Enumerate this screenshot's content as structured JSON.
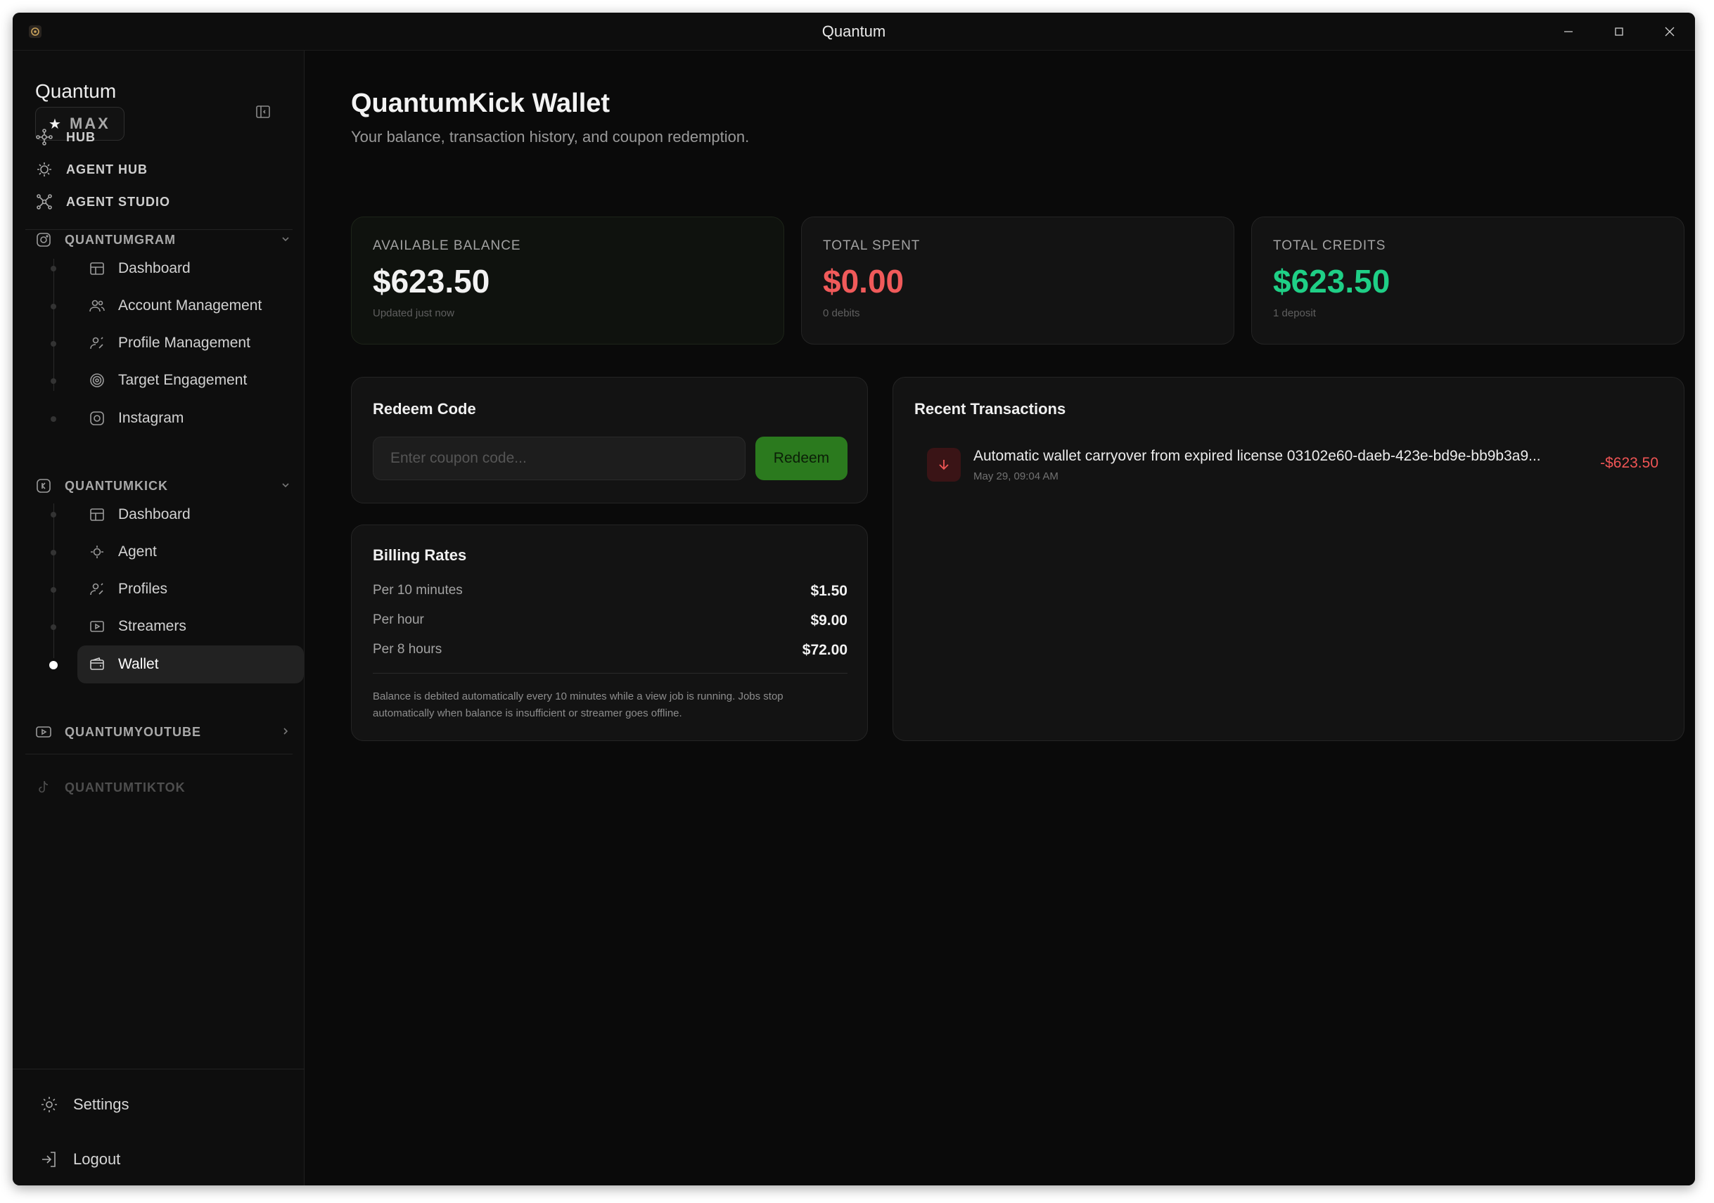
{
  "window": {
    "title": "Quantum"
  },
  "sidebar": {
    "brand": "Quantum",
    "plan_badge": "MAX",
    "top_nav": [
      {
        "label": "HUB",
        "icon": "hub-icon"
      },
      {
        "label": "AGENT HUB",
        "icon": "agent-icon"
      },
      {
        "label": "AGENT STUDIO",
        "icon": "network-icon"
      }
    ],
    "sections": {
      "quantumgram": {
        "label": "QUANTUMGRAM",
        "items": [
          "Dashboard",
          "Account Management",
          "Profile Management",
          "Target Engagement",
          "Instagram"
        ]
      },
      "quantumkick": {
        "label": "QUANTUMKICK",
        "items": [
          "Dashboard",
          "Agent",
          "Profiles",
          "Streamers",
          "Wallet"
        ]
      },
      "quantumyoutube": {
        "label": "QUANTUMYOUTUBE"
      },
      "quantumtiktok": {
        "label": "QUANTUMTIKTOK"
      }
    },
    "bottom": {
      "settings": "Settings",
      "logout": "Logout"
    }
  },
  "page": {
    "title": "QuantumKick Wallet",
    "subtitle": "Your balance, transaction history, and coupon redemption."
  },
  "stats": [
    {
      "label": "AVAILABLE BALANCE",
      "value": "$623.50",
      "note": "Updated just now",
      "color": "#f2f2f2"
    },
    {
      "label": "TOTAL SPENT",
      "value": "$0.00",
      "note": "0 debits",
      "color": "#f05a5a"
    },
    {
      "label": "TOTAL CREDITS",
      "value": "$623.50",
      "note": "1 deposit",
      "color": "#1fcf86"
    }
  ],
  "redeem": {
    "title": "Redeem Code",
    "placeholder": "Enter coupon code...",
    "button": "Redeem"
  },
  "billing": {
    "title": "Billing Rates",
    "rates": [
      {
        "label": "Per 10 minutes",
        "value": "$1.50"
      },
      {
        "label": "Per hour",
        "value": "$9.00"
      },
      {
        "label": "Per 8 hours",
        "value": "$72.00"
      }
    ],
    "note": "Balance is debited automatically every 10 minutes while a view job is running. Jobs stop automatically when balance is insufficient or streamer goes offline."
  },
  "transactions": {
    "title": "Recent Transactions",
    "items": [
      {
        "description": "Automatic wallet carryover from expired license 03102e60-daeb-423e-bd9e-bb9b3a9...",
        "date": "May 29, 09:04 AM",
        "amount": "-$623.50"
      }
    ]
  }
}
